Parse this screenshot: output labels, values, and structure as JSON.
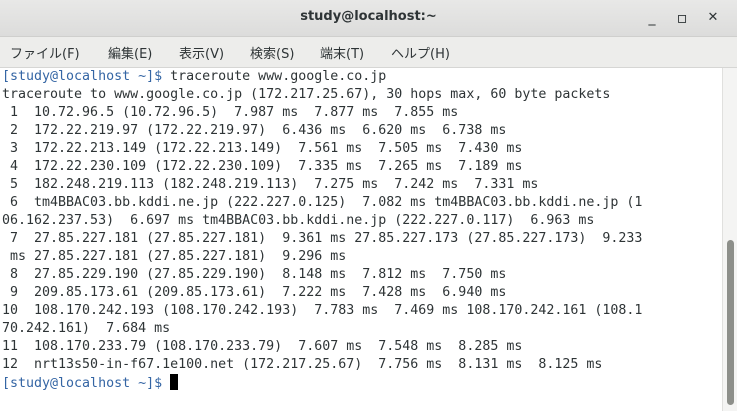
{
  "window": {
    "title": "study@localhost:~",
    "minimize_glyph": "_",
    "maximize_glyph": "▫",
    "close_glyph": "✕"
  },
  "menu": {
    "items": [
      {
        "label": "ファイル(F)"
      },
      {
        "label": "編集(E)"
      },
      {
        "label": "表示(V)"
      },
      {
        "label": "検索(S)"
      },
      {
        "label": "端末(T)"
      },
      {
        "label": "ヘルプ(H)"
      }
    ]
  },
  "terminal": {
    "prompt": "[study@localhost ~]$",
    "command": " traceroute www.google.co.jp",
    "output": [
      "traceroute to www.google.co.jp (172.217.25.67), 30 hops max, 60 byte packets",
      " 1  10.72.96.5 (10.72.96.5)  7.987 ms  7.877 ms  7.855 ms",
      " 2  172.22.219.97 (172.22.219.97)  6.436 ms  6.620 ms  6.738 ms",
      " 3  172.22.213.149 (172.22.213.149)  7.561 ms  7.505 ms  7.430 ms",
      " 4  172.22.230.109 (172.22.230.109)  7.335 ms  7.265 ms  7.189 ms",
      " 5  182.248.219.113 (182.248.219.113)  7.275 ms  7.242 ms  7.331 ms",
      " 6  tm4BBAC03.bb.kddi.ne.jp (222.227.0.125)  7.082 ms tm4BBAC03.bb.kddi.ne.jp (1",
      "06.162.237.53)  6.697 ms tm4BBAC03.bb.kddi.ne.jp (222.227.0.117)  6.963 ms",
      " 7  27.85.227.181 (27.85.227.181)  9.361 ms 27.85.227.173 (27.85.227.173)  9.233",
      " ms 27.85.227.181 (27.85.227.181)  9.296 ms",
      " 8  27.85.229.190 (27.85.229.190)  8.148 ms  7.812 ms  7.750 ms",
      " 9  209.85.173.61 (209.85.173.61)  7.222 ms  7.428 ms  6.940 ms",
      "10  108.170.242.193 (108.170.242.193)  7.783 ms  7.469 ms 108.170.242.161 (108.1",
      "70.242.161)  7.684 ms",
      "11  108.170.233.79 (108.170.233.79)  7.607 ms  7.548 ms  8.285 ms",
      "12  nrt13s50-in-f67.1e100.net (172.217.25.67)  7.756 ms  8.131 ms  8.125 ms"
    ],
    "final_prompt": "[study@localhost ~]$"
  },
  "colors": {
    "prompt": "#3465a4",
    "text": "#2e3436",
    "background": "#ffffff"
  }
}
